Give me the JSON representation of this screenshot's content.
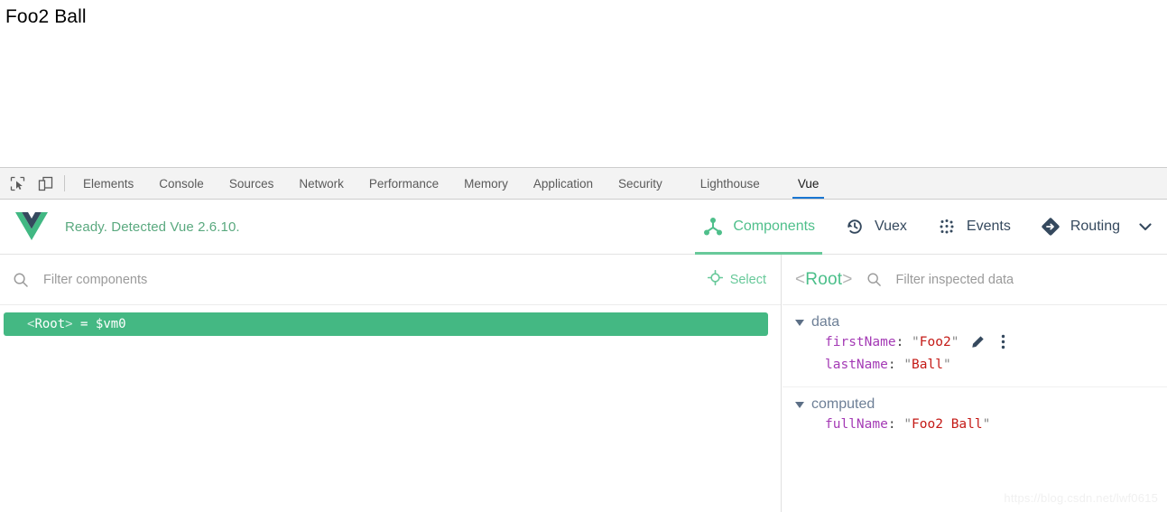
{
  "app": {
    "rendered_text": "Foo2 Ball"
  },
  "devtools": {
    "tool_icons": [
      {
        "name": "inspect-element-icon",
        "label": "Inspect element"
      },
      {
        "name": "device-toolbar-icon",
        "label": "Toggle device toolbar"
      }
    ],
    "tabs": [
      {
        "label": "Elements",
        "active": false
      },
      {
        "label": "Console",
        "active": false
      },
      {
        "label": "Sources",
        "active": false
      },
      {
        "label": "Network",
        "active": false
      },
      {
        "label": "Performance",
        "active": false
      },
      {
        "label": "Memory",
        "active": false
      },
      {
        "label": "Application",
        "active": false
      },
      {
        "label": "Security",
        "active": false
      },
      {
        "label": "Lighthouse",
        "active": false
      },
      {
        "label": "Vue",
        "active": true
      }
    ]
  },
  "vue_panel": {
    "status_text": "Ready. Detected Vue 2.6.10.",
    "logo_colors": {
      "outer": "#41b883",
      "inner": "#35495e"
    },
    "accent_green": "#41b883",
    "nav": [
      {
        "label": "Components",
        "icon": "component-tree-icon",
        "active": true
      },
      {
        "label": "Vuex",
        "icon": "history-clock-icon",
        "active": false
      },
      {
        "label": "Events",
        "icon": "events-dots-icon",
        "active": false
      },
      {
        "label": "Routing",
        "icon": "routing-diamond-icon",
        "active": false
      }
    ],
    "nav_overflow_icon": "chevron-down-icon"
  },
  "components_pane": {
    "filter_placeholder": "Filter components",
    "filter_value": "",
    "search_icon": "search-icon",
    "select_button": {
      "label": "Select",
      "icon": "target-crosshair-icon"
    },
    "tree": [
      {
        "tag_open": "<",
        "name": "Root",
        "tag_close": ">",
        "assignment": "= $vm0",
        "selected": true
      }
    ]
  },
  "inspector_pane": {
    "component_angle_open": "<",
    "component_name": "Root",
    "component_angle_close": ">",
    "search_icon": "search-icon",
    "filter_placeholder": "Filter inspected data",
    "filter_value": "",
    "groups": [
      {
        "title": "data",
        "expanded": true,
        "props": [
          {
            "key": "firstName",
            "value": "Foo2",
            "quoted": true,
            "actions": [
              "pencil-edit-icon",
              "more-vertical-icon"
            ]
          },
          {
            "key": "lastName",
            "value": "Ball",
            "quoted": true,
            "actions": []
          }
        ]
      },
      {
        "title": "computed",
        "expanded": true,
        "props": [
          {
            "key": "fullName",
            "value": "Foo2 Ball",
            "quoted": true,
            "actions": []
          }
        ]
      }
    ]
  },
  "watermark": {
    "text": "https://blog.csdn.net/lwf0615"
  }
}
